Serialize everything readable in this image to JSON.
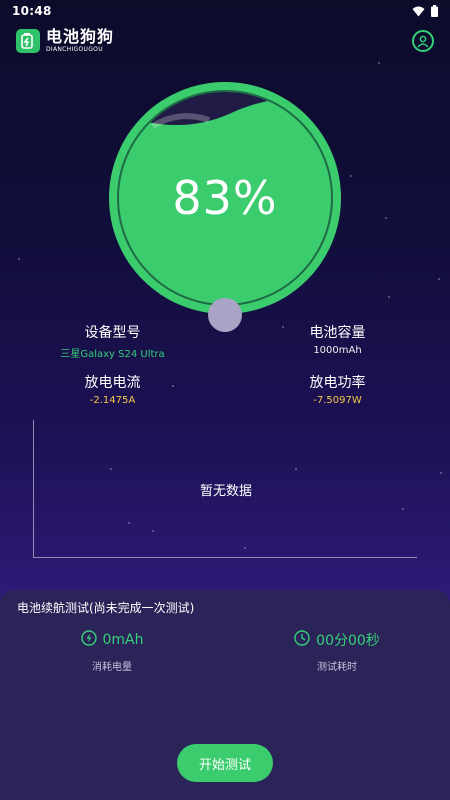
{
  "status_bar": {
    "time": "10:48",
    "icons": [
      "wifi-icon",
      "battery-icon"
    ]
  },
  "header": {
    "logo_cn": "电池狗狗",
    "logo_en": "DIANCHIGOUGOU",
    "profile_icon": "user-circle-icon"
  },
  "gauge": {
    "percent_text": "83%",
    "level": 0.83,
    "color": "#3bcc6e"
  },
  "info": {
    "device_model": {
      "label": "设备型号",
      "value": "三星Galaxy S24 Ultra"
    },
    "battery_capacity": {
      "label": "电池容量",
      "value": "1000mAh"
    },
    "discharge_current": {
      "label": "放电电流",
      "value": "-2.1475A"
    },
    "discharge_power": {
      "label": "放电功率",
      "value": "-7.5097W"
    }
  },
  "chart": {
    "empty_text": "暂无数据"
  },
  "endurance": {
    "title": "电池续航测试(尚未完成一次测试)",
    "consumed": {
      "value": "0mAh",
      "label": "消耗电量",
      "icon": "lightning-icon"
    },
    "duration": {
      "value": "00分00秒",
      "label": "测试耗时",
      "icon": "clock-icon"
    },
    "start_button": "开始测试"
  },
  "colors": {
    "accent": "#3bcc6e",
    "warning": "#f2c94c",
    "panel": "#2a2458"
  }
}
